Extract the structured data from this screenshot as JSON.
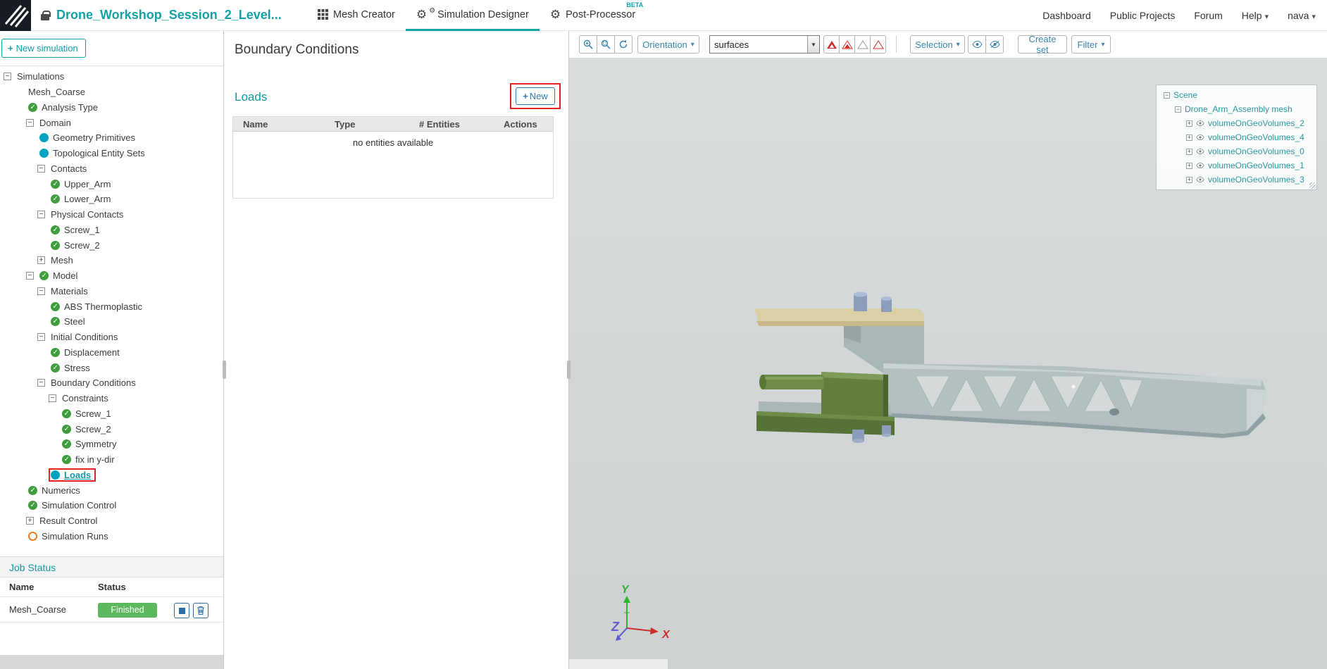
{
  "topbar": {
    "project_title": "Drone_Workshop_Session_2_Level...",
    "beta_label": "BETA",
    "tabs": [
      {
        "label": "Mesh Creator"
      },
      {
        "label": "Simulation Designer"
      },
      {
        "label": "Post-Processor"
      }
    ],
    "links": {
      "dashboard": "Dashboard",
      "public_projects": "Public Projects",
      "forum": "Forum",
      "help": "Help",
      "user": "nava"
    }
  },
  "sidebar": {
    "new_simulation_label": "New simulation",
    "tree": [
      {
        "label": "Simulations",
        "level": 0,
        "expander": "minus"
      },
      {
        "label": "Mesh_Coarse",
        "level": 2
      },
      {
        "label": "Analysis Type",
        "level": 2,
        "icon": "check"
      },
      {
        "label": "Domain",
        "level": 2,
        "expander": "minus"
      },
      {
        "label": "Geometry Primitives",
        "level": 3,
        "icon": "dot"
      },
      {
        "label": "Topological Entity Sets",
        "level": 3,
        "icon": "dot"
      },
      {
        "label": "Contacts",
        "level": 3,
        "expander": "minus"
      },
      {
        "label": "Upper_Arm",
        "level": 4,
        "icon": "check"
      },
      {
        "label": "Lower_Arm",
        "level": 4,
        "icon": "check"
      },
      {
        "label": "Physical Contacts",
        "level": 3,
        "expander": "minus"
      },
      {
        "label": "Screw_1",
        "level": 4,
        "icon": "check"
      },
      {
        "label": "Screw_2",
        "level": 4,
        "icon": "check"
      },
      {
        "label": "Mesh",
        "level": 3,
        "expander": "plus"
      },
      {
        "label": "Model",
        "level": 2,
        "expander": "minus",
        "icon": "check"
      },
      {
        "label": "Materials",
        "level": 3,
        "expander": "minus"
      },
      {
        "label": "ABS Thermoplastic",
        "level": 4,
        "icon": "check"
      },
      {
        "label": "Steel",
        "level": 4,
        "icon": "check"
      },
      {
        "label": "Initial Conditions",
        "level": 3,
        "expander": "minus"
      },
      {
        "label": "Displacement",
        "level": 4,
        "icon": "check"
      },
      {
        "label": "Stress",
        "level": 4,
        "icon": "check"
      },
      {
        "label": "Boundary Conditions",
        "level": 3,
        "expander": "minus"
      },
      {
        "label": "Constraints",
        "level": 4,
        "expander": "minus"
      },
      {
        "label": "Screw_1",
        "level": 5,
        "icon": "check"
      },
      {
        "label": "Screw_2",
        "level": 5,
        "icon": "check"
      },
      {
        "label": "Symmetry",
        "level": 5,
        "icon": "check"
      },
      {
        "label": "fix in y-dir",
        "level": 5,
        "icon": "check"
      },
      {
        "label": "Loads",
        "level": 4,
        "icon": "dot",
        "selected": true
      },
      {
        "label": "Numerics",
        "level": 2,
        "icon": "check"
      },
      {
        "label": "Simulation Control",
        "level": 2,
        "icon": "check"
      },
      {
        "label": "Result Control",
        "level": 2,
        "expander": "plus"
      },
      {
        "label": "Simulation Runs",
        "level": 2,
        "icon": "circle"
      }
    ],
    "job_status": {
      "title": "Job Status",
      "columns": [
        "Name",
        "Status"
      ],
      "rows": [
        {
          "name": "Mesh_Coarse",
          "status": "Finished"
        }
      ]
    }
  },
  "panel": {
    "title": "Boundary Conditions",
    "section_title": "Loads",
    "new_button_label": "New",
    "table": {
      "columns": [
        "Name",
        "Type",
        "# Entities",
        "Actions"
      ],
      "empty_text": "no entities available"
    }
  },
  "viewer": {
    "toolbar": {
      "orientation_label": "Orientation",
      "render_mode_value": "surfaces",
      "selection_label": "Selection",
      "create_set_label": "Create set",
      "filter_label": "Filter"
    },
    "scene_tree": {
      "root_label": "Scene",
      "mesh_label": "Drone_Arm_Assembly mesh",
      "volumes": [
        {
          "label": "volumeOnGeoVolumes_2"
        },
        {
          "label": "volumeOnGeoVolumes_4"
        },
        {
          "label": "volumeOnGeoVolumes_0"
        },
        {
          "label": "volumeOnGeoVolumes_1"
        },
        {
          "label": "volumeOnGeoVolumes_3"
        }
      ]
    },
    "axes": {
      "x": "X",
      "y": "Y",
      "z": "Z"
    }
  },
  "icons": {
    "logo": "simscale-logo",
    "project": "lock-icon",
    "mesh_creator": "grid-icon",
    "simulation_designer": "gears-icon",
    "post_processor": "gear-icon",
    "zoom_in": "magnifier-plus-icon",
    "zoom_window": "magnifier-box-icon",
    "reset_view": "refresh-icon",
    "quality_filters": "triangle-icons",
    "show": "eye-icon",
    "hide": "eye-slash-icon",
    "stop_job": "square-stop-icon",
    "delete_job": "trash-icon",
    "tree_expand": "plus-box-icon",
    "tree_collapse": "minus-box-icon",
    "status_done": "check-circle-icon",
    "status_selected": "dot-circle-icon",
    "status_pending": "ring-circle-icon"
  },
  "colors": {
    "accent_teal": "#14a0a8",
    "action_blue": "#2e7bb8",
    "toolbar_blue": "#3a87ad",
    "success_green": "#5cb85c",
    "annotation_red": "#e32222",
    "check_green": "#3f9c3f",
    "dot_teal": "#00a3c0",
    "pending_orange": "#ef7b1a",
    "viewport_gray": "#d2d6d6"
  }
}
